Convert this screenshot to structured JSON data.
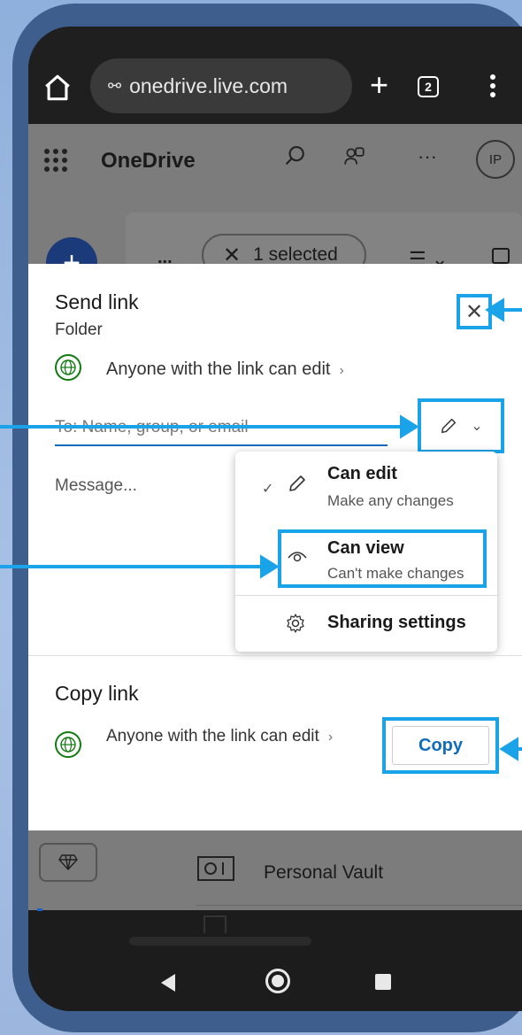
{
  "browser": {
    "url": "onedrive.live.com",
    "tab_count": "2"
  },
  "app": {
    "title": "OneDrive",
    "avatar_initials": "IP",
    "toolbar": {
      "ellipsis": "...",
      "selected_label": "1 selected"
    }
  },
  "send_link": {
    "title": "Send link",
    "subtitle": "Folder",
    "permission_text": "Anyone with the link can edit",
    "to_placeholder": "To: Name, group, or email",
    "message_placeholder": "Message...",
    "menu": {
      "items": [
        {
          "label": "Can edit",
          "description": "Make any changes",
          "checked": true,
          "icon": "pencil-icon"
        },
        {
          "label": "Can view",
          "description": "Can't make changes",
          "checked": false,
          "icon": "eye-icon"
        },
        {
          "label": "Sharing settings",
          "icon": "gear-icon"
        }
      ]
    }
  },
  "copy_link": {
    "title": "Copy link",
    "permission_text": "Anyone with the link can edit",
    "button_label": "Copy"
  },
  "list": {
    "items": [
      {
        "label": "Personal Vault",
        "icon": "vault-icon"
      }
    ]
  },
  "colors": {
    "highlight": "#1aa3e8",
    "link_blue": "#0f6cbd",
    "globe_green": "#107c10",
    "frame": "#3e5f8e"
  }
}
